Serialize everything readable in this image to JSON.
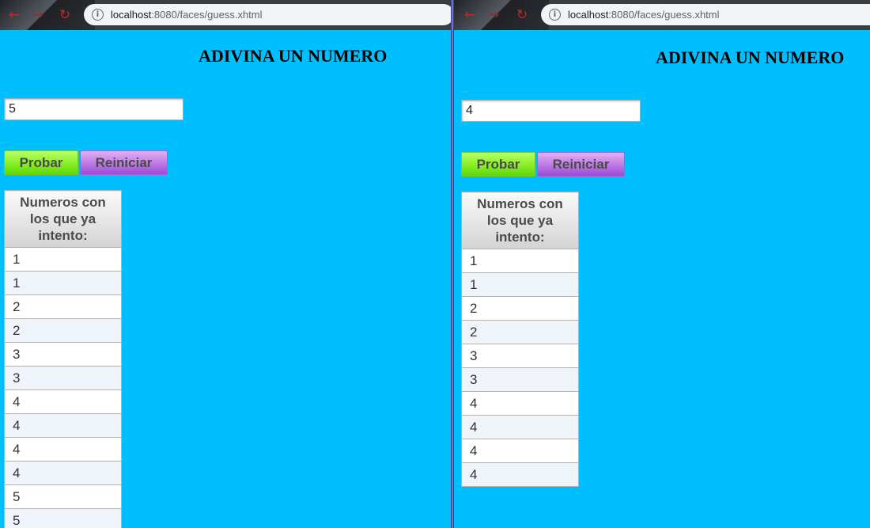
{
  "windows": [
    {
      "id": "left",
      "url_host": "localhost",
      "url_path": ":8080/faces/guess.xhtml",
      "page_title": "ADIVINA UN NUMERO",
      "guess_value": "5",
      "probar_label": "Probar",
      "reiniciar_label": "Reiniciar",
      "table_header": "Numeros con los que ya intento:",
      "attempts": [
        "1",
        "1",
        "2",
        "2",
        "3",
        "3",
        "4",
        "4",
        "4",
        "4",
        "5",
        "5"
      ]
    },
    {
      "id": "right",
      "url_host": "localhost",
      "url_path": ":8080/faces/guess.xhtml",
      "page_title": "ADIVINA UN NUMERO",
      "guess_value": "4",
      "probar_label": "Probar",
      "reiniciar_label": "Reiniciar",
      "table_header": "Numeros con los que ya intento:",
      "attempts": [
        "1",
        "1",
        "2",
        "2",
        "3",
        "3",
        "4",
        "4",
        "4",
        "4"
      ]
    }
  ],
  "icons": {
    "back": "arrow-left-icon",
    "forward": "arrow-right-icon",
    "reload": "reload-icon",
    "info": "info-icon"
  },
  "colors": {
    "page_background": "#00bfff",
    "probar_button": "#8cf02a",
    "reiniciar_button": "#c07de6"
  }
}
